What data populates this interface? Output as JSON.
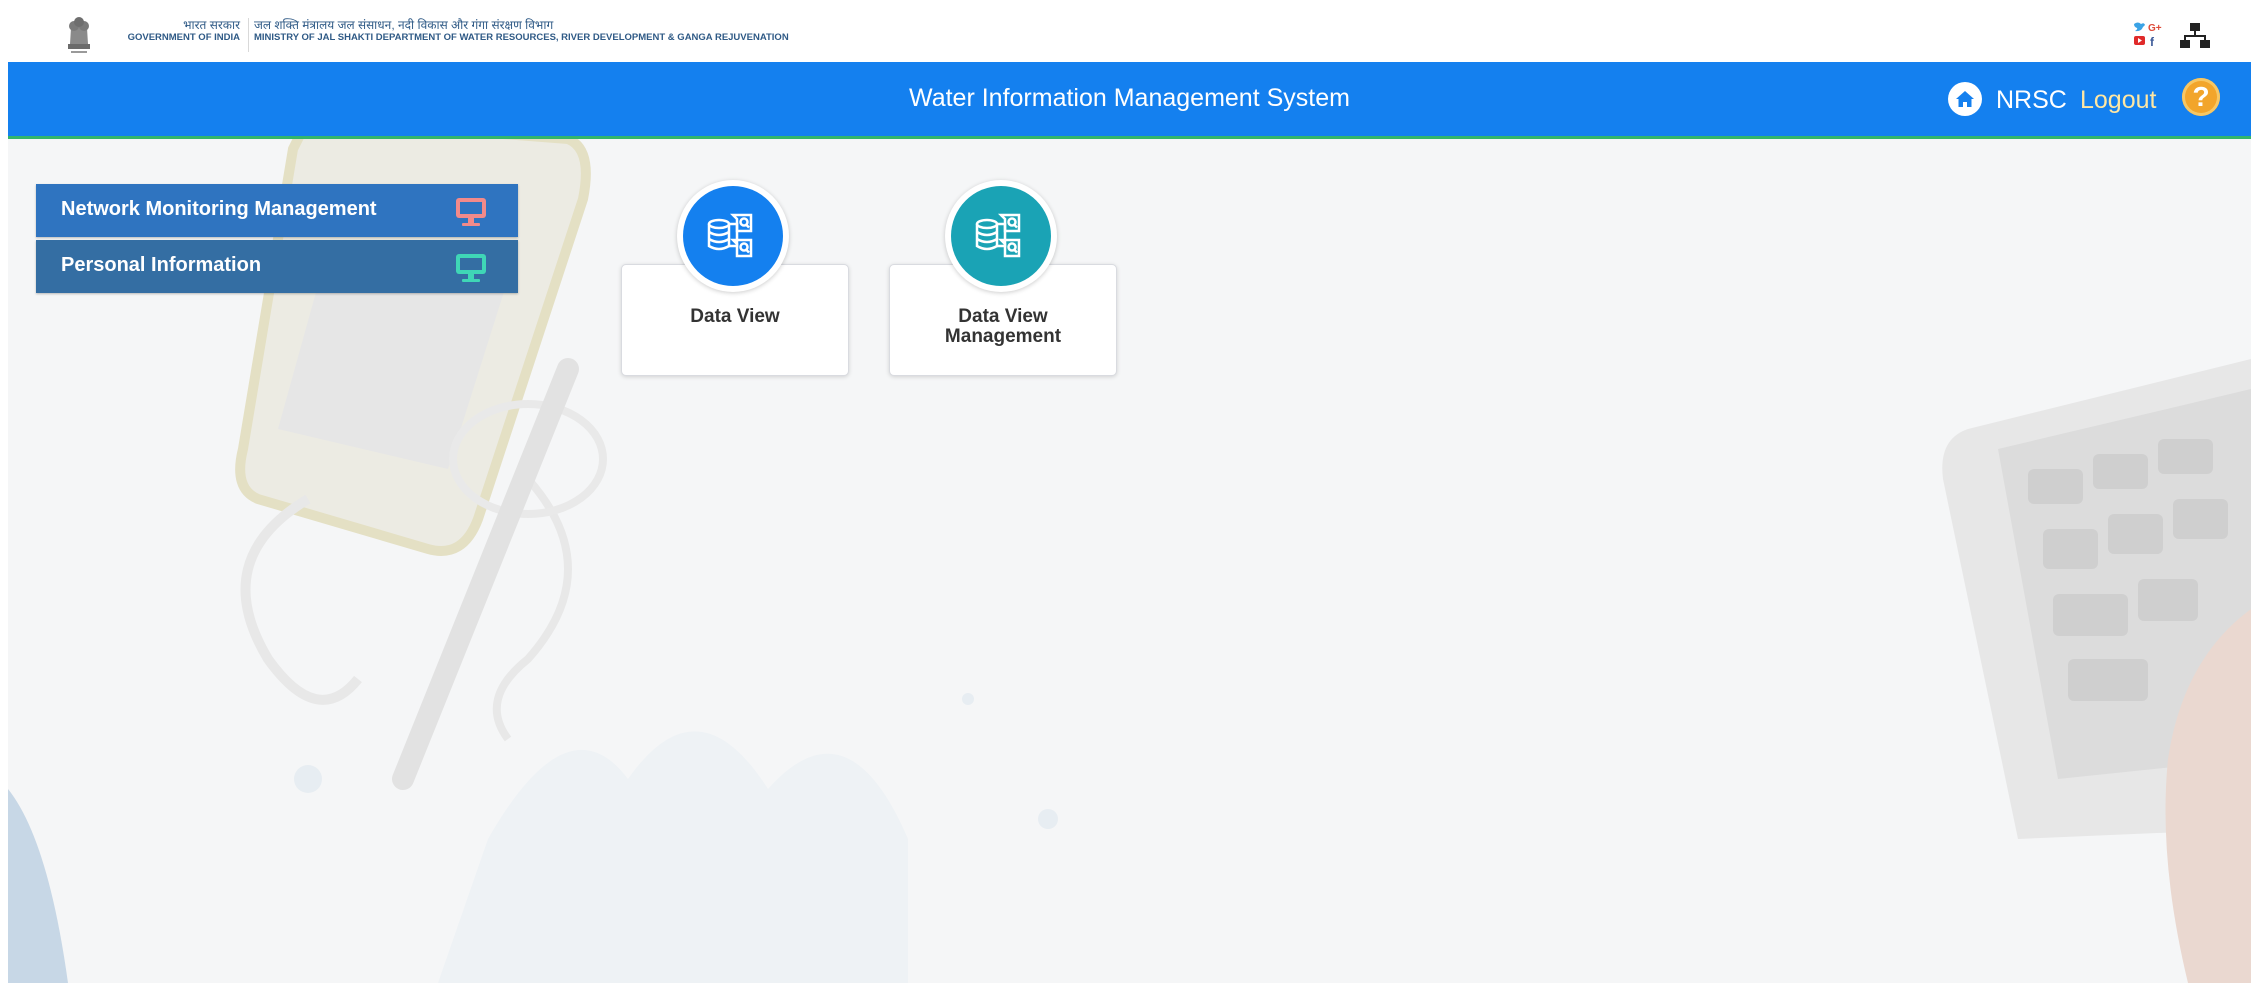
{
  "gov": {
    "hindi": "भारत सरकार",
    "english": "GOVERNMENT OF INDIA"
  },
  "ministry": {
    "hindi": "जल शक्ति मंत्रालय जल संसाधन, नदी विकास और गंगा संरक्षण विभाग",
    "english": "MINISTRY OF JAL SHAKTI DEPARTMENT OF WATER RESOURCES, RIVER DEVELOPMENT & GANGA REJUVENATION"
  },
  "header": {
    "title": "Water Information Management System",
    "user": "NRSC",
    "logout": "Logout",
    "help_glyph": "?"
  },
  "menu": {
    "items": [
      {
        "label": "Network Monitoring Management",
        "icon": "monitor-icon",
        "icon_color": "#f28a8a"
      },
      {
        "label": "Personal Information",
        "icon": "monitor-icon",
        "icon_color": "#3fd6b6"
      }
    ]
  },
  "tiles": [
    {
      "label": "Data View",
      "icon": "database-icon",
      "color": "#1480ef"
    },
    {
      "label": "Data View Management",
      "icon": "database-icon",
      "color": "#1aa3b5"
    }
  ],
  "colors": {
    "header": "#1480ef",
    "header_border": "#34b56a",
    "menu": "#2f74c0",
    "logout": "#ffe7a3",
    "help": "#f2a52b"
  }
}
